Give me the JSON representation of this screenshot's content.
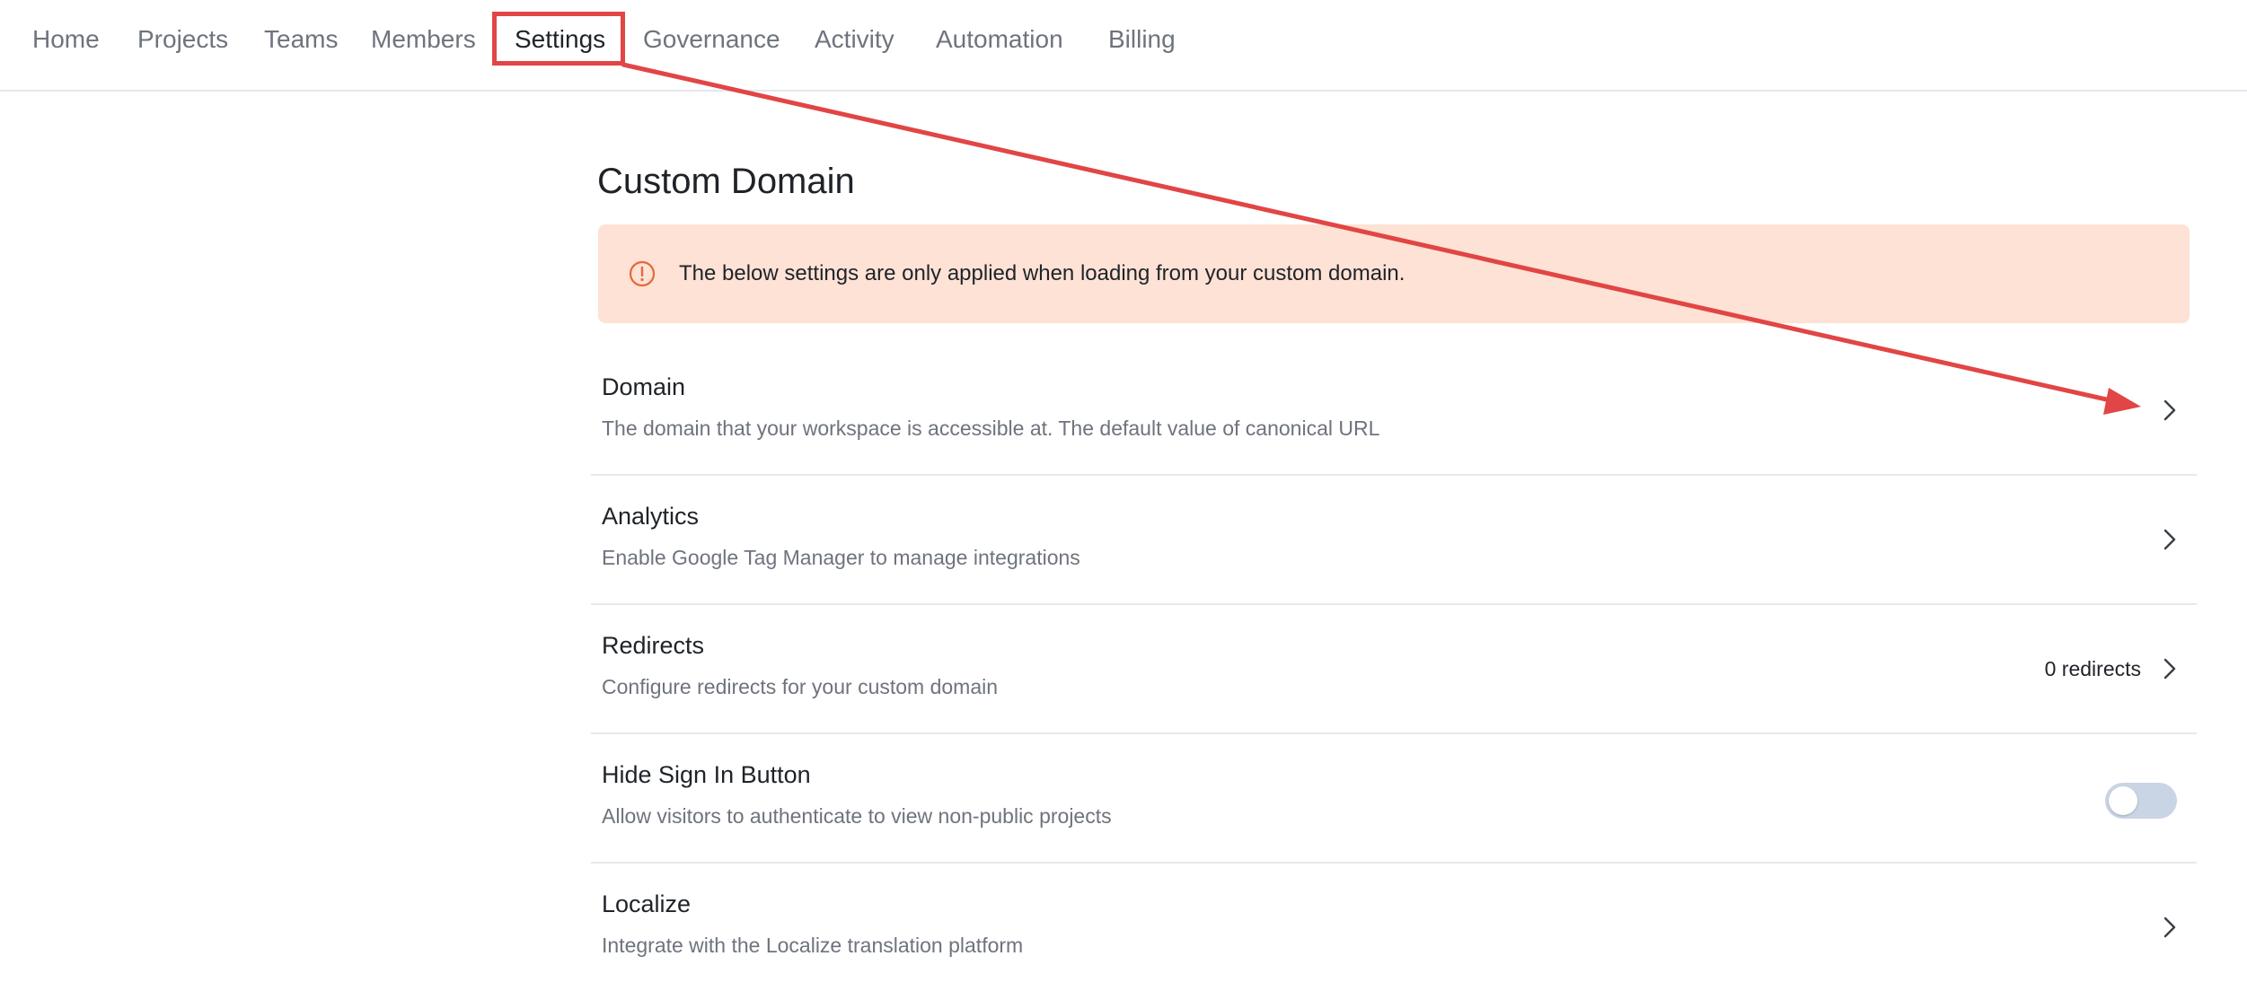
{
  "nav": {
    "items": [
      {
        "label": "Home"
      },
      {
        "label": "Projects"
      },
      {
        "label": "Teams"
      },
      {
        "label": "Members"
      },
      {
        "label": "Settings",
        "active": true
      },
      {
        "label": "Governance"
      },
      {
        "label": "Activity"
      },
      {
        "label": "Automation"
      },
      {
        "label": "Billing"
      }
    ]
  },
  "page": {
    "title": "Custom Domain",
    "notice": {
      "text": "The below settings are only applied when loading from your custom domain.",
      "icon": "alert-circle-icon"
    }
  },
  "settings": [
    {
      "title": "Domain",
      "description": "The domain that your workspace is accessible at. The default value of canonical URL"
    },
    {
      "title": "Analytics",
      "description": "Enable Google Tag Manager to manage integrations"
    },
    {
      "title": "Redirects",
      "description": "Configure redirects for your custom domain",
      "meta": "0 redirects"
    },
    {
      "title": "Hide Sign In Button",
      "description": "Allow visitors to authenticate to view non-public projects",
      "toggle": false
    },
    {
      "title": "Localize",
      "description": "Integrate with the Localize translation platform"
    }
  ],
  "colors": {
    "annotation": "#e24545",
    "notice_bg": "#fde2d5",
    "notice_icon": "#e8673a",
    "toggle_off": "#c9d4e5"
  }
}
